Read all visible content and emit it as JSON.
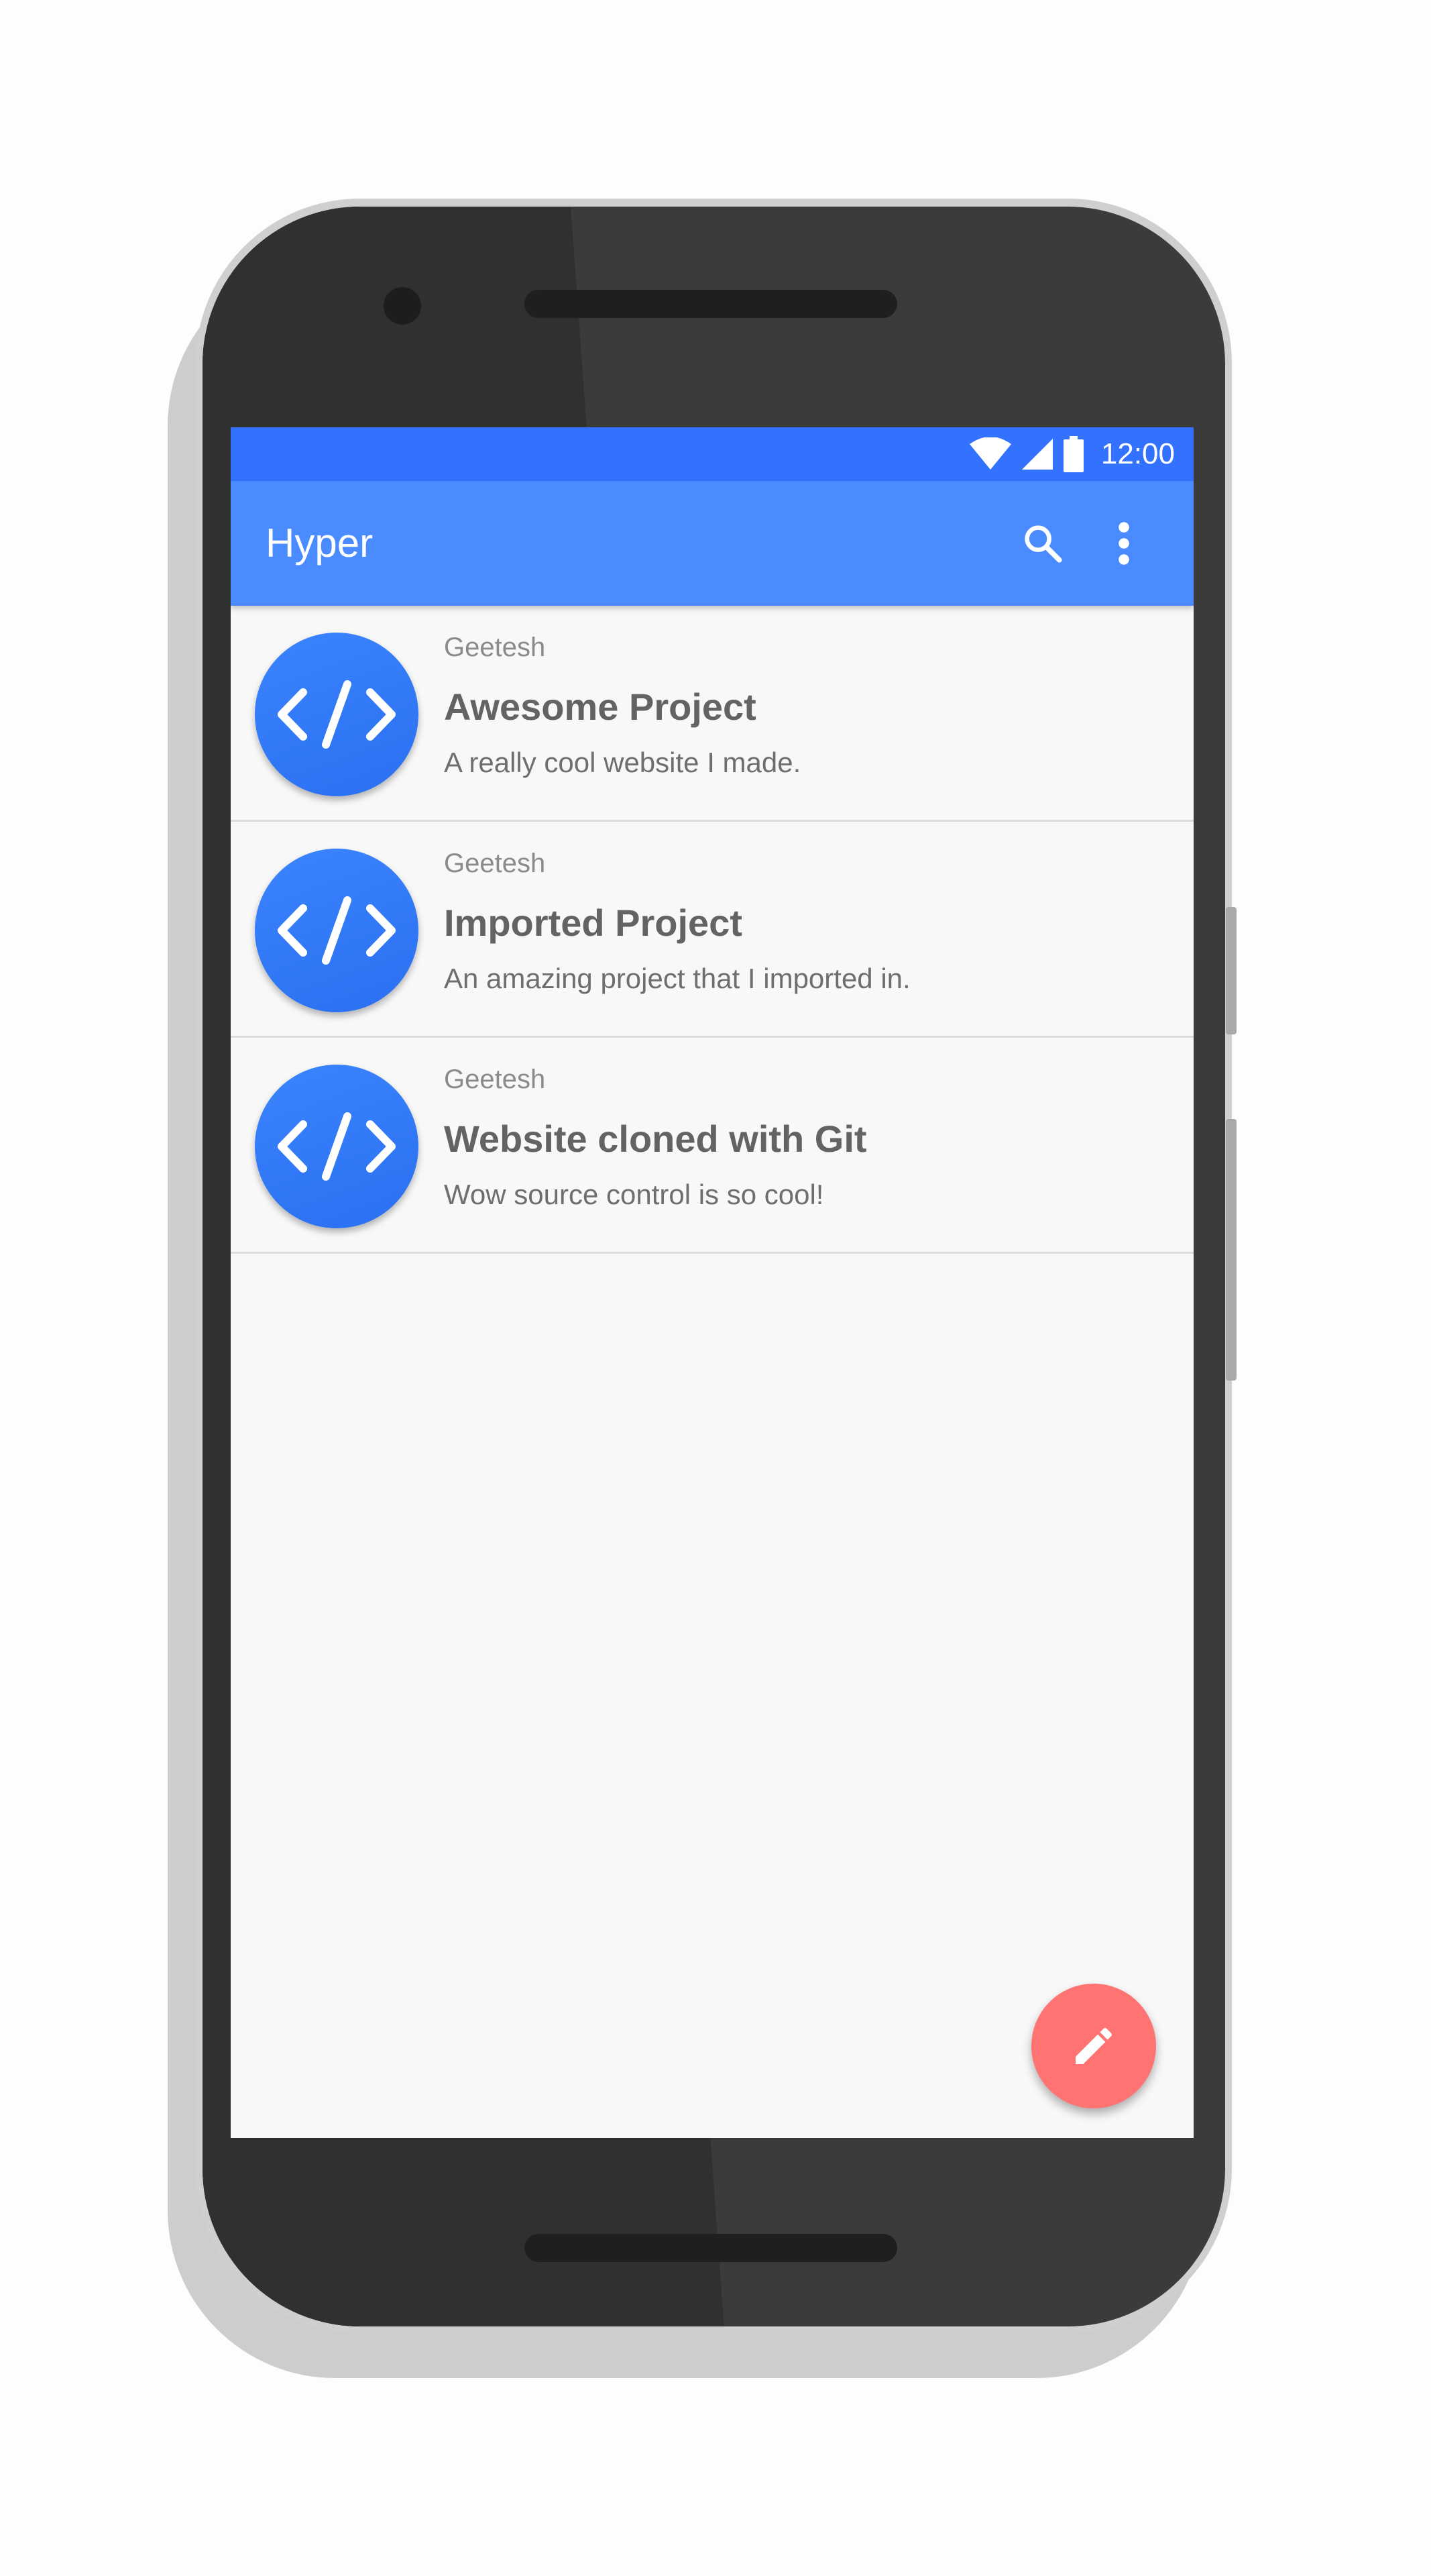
{
  "status_bar": {
    "time": "12:00",
    "icons": [
      "wifi-icon",
      "cell-signal-icon",
      "battery-icon"
    ]
  },
  "app_bar": {
    "title": "Hyper",
    "actions": [
      "search-icon",
      "more-vert-icon"
    ]
  },
  "projects": [
    {
      "owner": "Geetesh",
      "title": "Awesome Project",
      "description": "A really cool website I made.",
      "icon": "code-icon"
    },
    {
      "owner": "Geetesh",
      "title": "Imported Project",
      "description": "An amazing project that I imported in.",
      "icon": "code-icon"
    },
    {
      "owner": "Geetesh",
      "title": "Website cloned with Git",
      "description": "Wow source control is so cool!",
      "icon": "code-icon"
    }
  ],
  "fab": {
    "icon": "pencil-icon"
  },
  "colors": {
    "status_bar": "#3372ff",
    "app_bar": "#4a8cff",
    "avatar": "#2f79f8",
    "fab": "#ff7373",
    "phone_body": "#3b3b3b"
  }
}
